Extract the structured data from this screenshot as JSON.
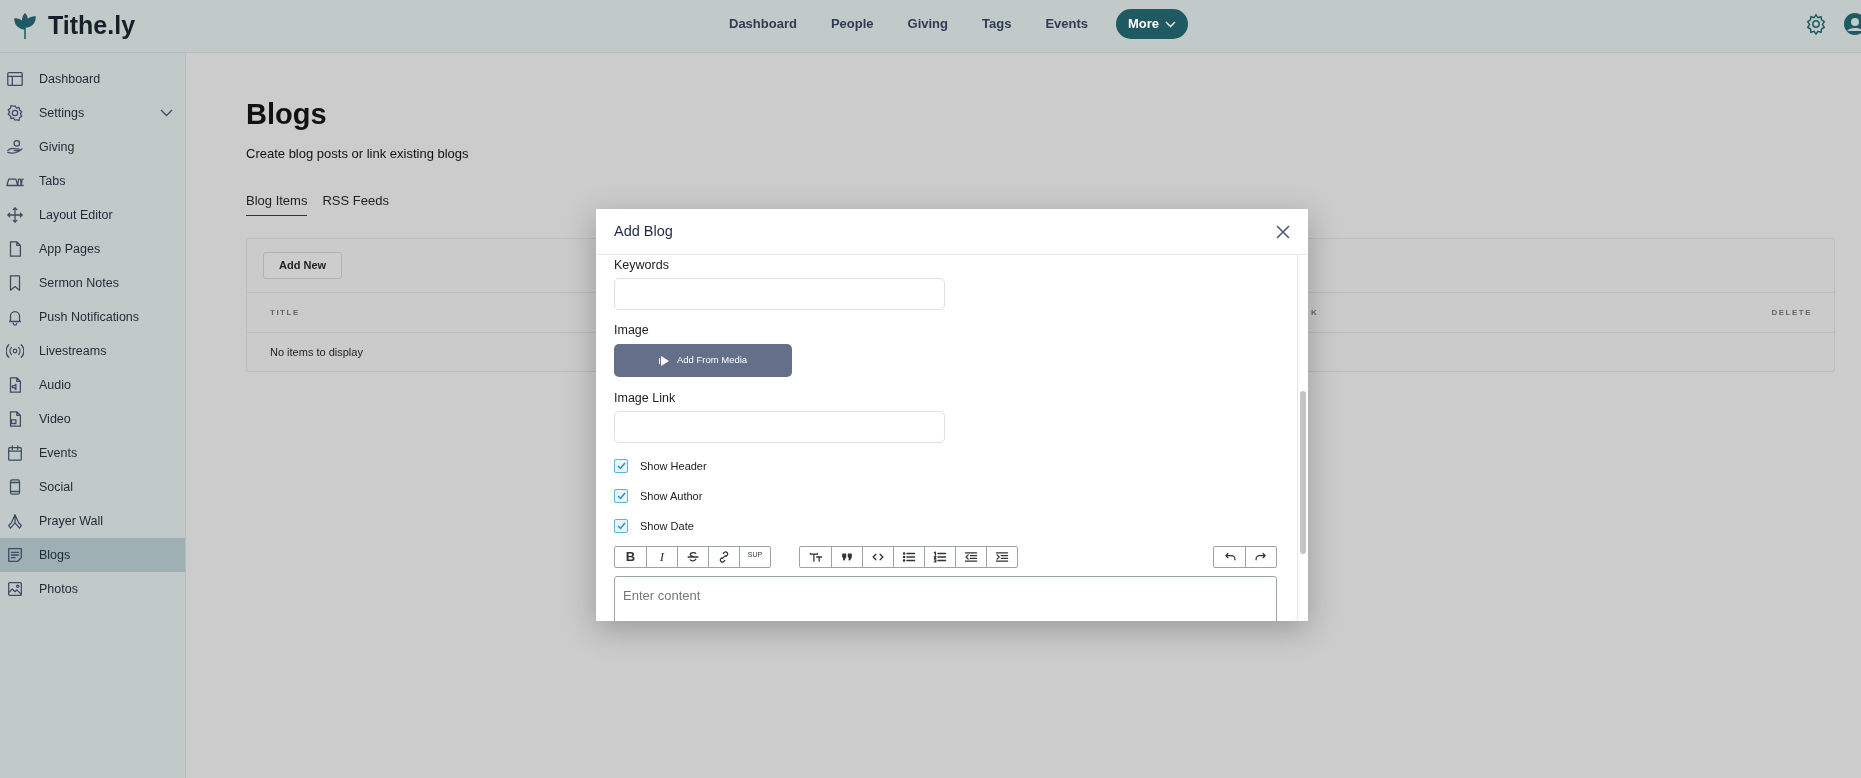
{
  "brand": "Tithe.ly",
  "topnav": [
    {
      "label": "Dashboard",
      "selected": false
    },
    {
      "label": "People",
      "selected": false
    },
    {
      "label": "Giving",
      "selected": false
    },
    {
      "label": "Tags",
      "selected": false
    },
    {
      "label": "Events",
      "selected": false
    },
    {
      "label": "More",
      "selected": true
    }
  ],
  "sidebar": {
    "items": [
      {
        "label": "Dashboard",
        "selected": false
      },
      {
        "label": "Settings",
        "selected": false,
        "expanded": false
      },
      {
        "label": "Giving",
        "selected": false
      },
      {
        "label": "Tabs",
        "selected": false
      },
      {
        "label": "Layout Editor",
        "selected": false
      },
      {
        "label": "App Pages",
        "selected": false
      },
      {
        "label": "Sermon Notes",
        "selected": false
      },
      {
        "label": "Push Notifications",
        "selected": false
      },
      {
        "label": "Livestreams",
        "selected": false
      },
      {
        "label": "Audio",
        "selected": false
      },
      {
        "label": "Video",
        "selected": false
      },
      {
        "label": "Events",
        "selected": false
      },
      {
        "label": "Social",
        "selected": false
      },
      {
        "label": "Prayer Wall",
        "selected": false
      },
      {
        "label": "Blogs",
        "selected": true
      },
      {
        "label": "Photos",
        "selected": false
      }
    ]
  },
  "page": {
    "title": "Blogs",
    "subtitle": "Create blog posts or link existing blogs",
    "tabs": [
      {
        "label": "Blog Items",
        "selected": true
      },
      {
        "label": "RSS Feeds",
        "selected": false
      }
    ],
    "add_button": "Add New",
    "table": {
      "columns": [
        "TITLE",
        "K",
        "DELETE"
      ],
      "empty_text": "No items to display"
    }
  },
  "modal": {
    "title": "Add Blog",
    "keywords": {
      "label": "Keywords"
    },
    "image": {
      "label": "Image",
      "button": "Add From Media"
    },
    "image_link": {
      "label": "Image Link"
    },
    "checkboxes": [
      {
        "label": "Show Header",
        "checked": true
      },
      {
        "label": "Show Author",
        "checked": true
      },
      {
        "label": "Show Date",
        "checked": true
      }
    ],
    "toolbar": [
      [
        {
          "kind": "bold",
          "label": "B"
        },
        {
          "kind": "italic",
          "label": "I"
        },
        {
          "kind": "icon"
        },
        {
          "kind": "icon"
        },
        {
          "kind": "sup",
          "label": "SUP"
        }
      ],
      [
        {
          "kind": "icon"
        },
        {
          "kind": "icon"
        },
        {
          "kind": "icon"
        },
        {
          "kind": "icon"
        },
        {
          "kind": "icon"
        },
        {
          "kind": "icon"
        },
        {
          "kind": "icon"
        }
      ],
      [
        {
          "kind": "icon"
        },
        {
          "kind": "icon"
        }
      ]
    ],
    "editor": {
      "placeholder": "Enter content"
    }
  }
}
